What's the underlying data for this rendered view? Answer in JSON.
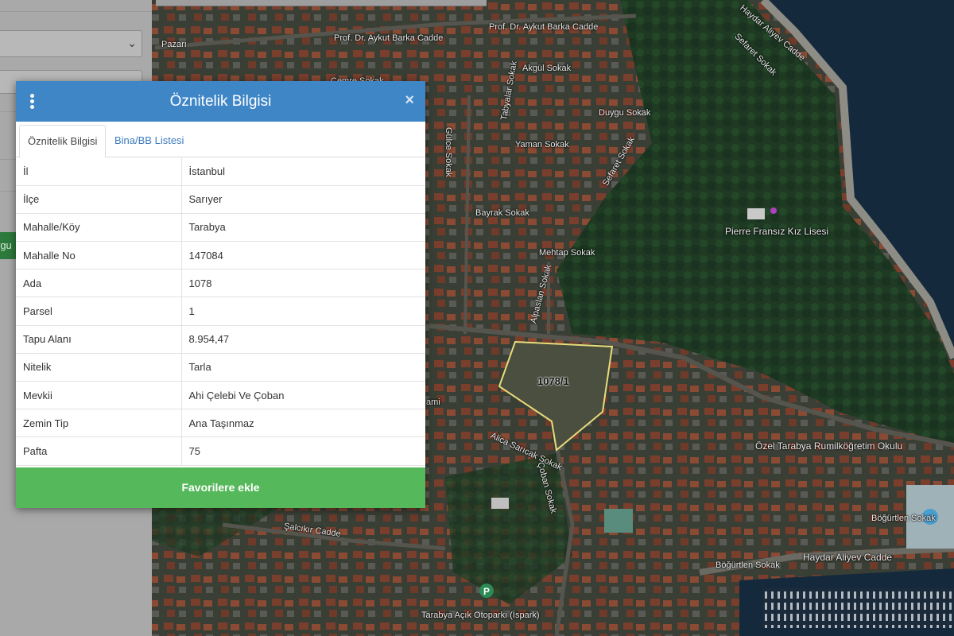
{
  "side_panel": {
    "top_link": "",
    "button_text": "rgu"
  },
  "map": {
    "parcel_label": "1078/1",
    "street_labels": [
      "Prof. Dr. Aykut Barka Cadde",
      "Prof. Dr. Aykut Barka Cadde",
      "Pazarı",
      "Cemre Sokak",
      "Akgül Sokak",
      "Duygu Sokak",
      "Yaman Sokak",
      "Gülce Sokak",
      "Tabyalar Sokak",
      "Bayrak Sokak",
      "Sefaret Sokak",
      "Mehtap Sokak",
      "Alpaslan Sokak",
      "Sefaret Sokak",
      "Pierre Fransız Kız Lisesi",
      "Haydar Aliyev Cadde",
      "Özel Tarabya Rumilköğretim Okulu",
      "Çoban Sokak",
      "Alica Sarıcak Sokak",
      "Şalcıkır Cadde",
      "Tarabya Açık Otoparkı (İspark)",
      "Böğürtlen Sokak",
      "Böğürtlen Sokak",
      "Haydar Aliyev Cadde",
      "ami",
      "Haydar Aliyev Cadde"
    ]
  },
  "dialog": {
    "title": "Öznitelik Bilgisi",
    "close_glyph": "×",
    "tabs": [
      {
        "label": "Öznitelik Bilgisi",
        "active": true
      },
      {
        "label": "Bina/BB Listesi",
        "active": false
      }
    ],
    "rows": [
      {
        "key": "İl",
        "value": "İstanbul"
      },
      {
        "key": "İlçe",
        "value": "Sarıyer"
      },
      {
        "key": "Mahalle/Köy",
        "value": "Tarabya"
      },
      {
        "key": "Mahalle No",
        "value": "147084"
      },
      {
        "key": "Ada",
        "value": "1078"
      },
      {
        "key": "Parsel",
        "value": "1"
      },
      {
        "key": "Tapu Alanı",
        "value": "8.954,47"
      },
      {
        "key": "Nitelik",
        "value": "Tarla"
      },
      {
        "key": "Mevkii",
        "value": "Ahi Çelebi Ve Çoban"
      },
      {
        "key": "Zemin Tip",
        "value": "Ana Taşınmaz"
      },
      {
        "key": "Pafta",
        "value": "75"
      }
    ],
    "favorite_button": "Favorilere ekle"
  },
  "colors": {
    "header": "#3f86c6",
    "favorite_button": "#55b85a",
    "parcel_outline": "#e8dc7a"
  },
  "icons": [
    "kebab-menu-icon",
    "close-icon",
    "chevron-down-icon",
    "parking-icon"
  ]
}
